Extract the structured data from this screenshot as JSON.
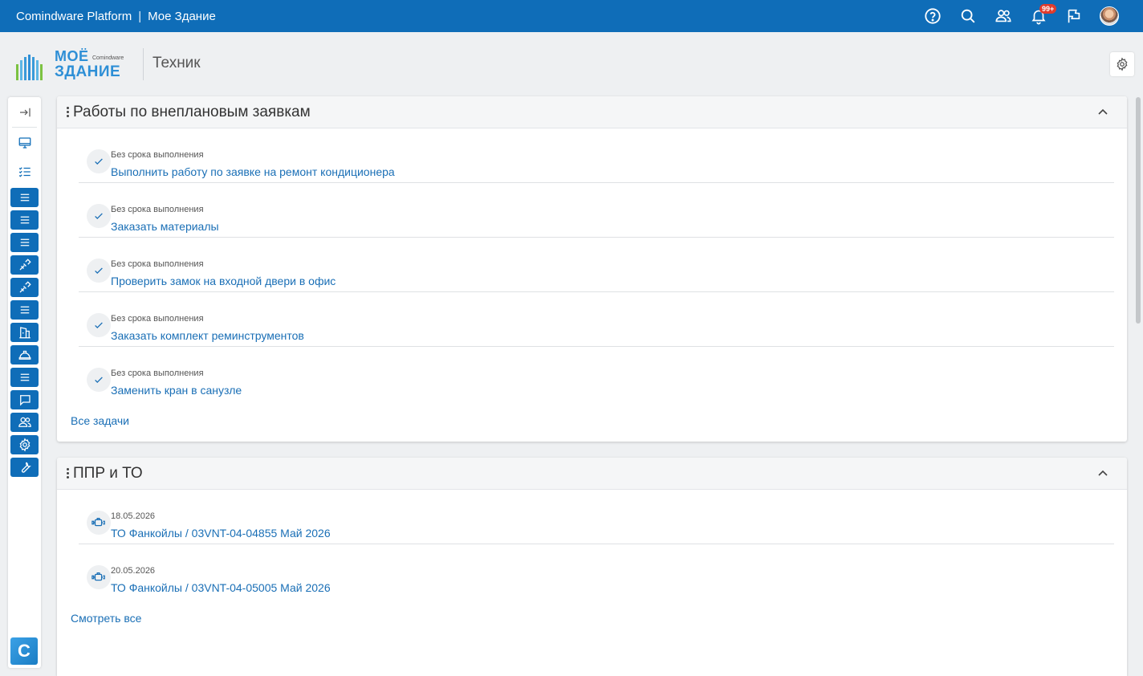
{
  "topbar": {
    "platform": "Comindware Platform",
    "separator": "|",
    "app_name": "Мое Здание",
    "notifications_badge": "99+",
    "icons": [
      "help-icon",
      "search-icon",
      "users-icon",
      "bell-icon",
      "flag-icon",
      "avatar"
    ]
  },
  "header": {
    "logo_line1": "МОЁ",
    "logo_line2": "ЗДАНИЕ",
    "logo_small": "Comindware",
    "page_title": "Техник"
  },
  "sidebar": {
    "items": [
      "collapse-sidebar-icon",
      "desktop-icon",
      "checklist-icon",
      "list-icon",
      "list-icon",
      "list-icon",
      "tool-icon",
      "tool-icon",
      "list-icon",
      "building-icon",
      "helmet-icon",
      "list-icon",
      "chat-icon",
      "users-icon",
      "gear-icon",
      "wrench-icon"
    ],
    "footer_logo": "C"
  },
  "panel_tasks": {
    "title": "Работы по внеплановым заявкам",
    "items": [
      {
        "meta": "Без срока выполнения",
        "title": "Выполнить работу по заявке на ремонт кондиционера"
      },
      {
        "meta": "Без срока выполнения",
        "title": "Заказать материалы"
      },
      {
        "meta": "Без срока выполнения",
        "title": "Проверить замок на входной двери в офис"
      },
      {
        "meta": "Без срока выполнения",
        "title": "Заказать комплект реминструментов"
      },
      {
        "meta": "Без срока выполнения",
        "title": "Заменить кран в санузле"
      }
    ],
    "all_link": "Все задачи"
  },
  "panel_ppr": {
    "title": "ППР и ТО",
    "items": [
      {
        "meta": "18.05.2026",
        "title": "ТО Фанкойлы / 03VNT-04-04855 Май 2026"
      },
      {
        "meta": "20.05.2026",
        "title": "ТО Фанкойлы / 03VNT-04-05005 Май 2026"
      }
    ],
    "all_link": "Смотреть все"
  },
  "colors": {
    "topbar": "#0f6db8",
    "link": "#1a6fb6",
    "badge": "#e03b2c"
  }
}
